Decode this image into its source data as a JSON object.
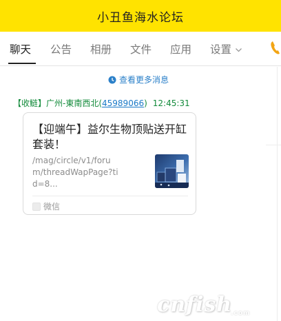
{
  "window": {
    "title": "小丑鱼海水论坛",
    "title_bar_color": "#ffe300"
  },
  "tabs": [
    {
      "label": "聊天",
      "active": true
    },
    {
      "label": "公告",
      "active": false
    },
    {
      "label": "相册",
      "active": false
    },
    {
      "label": "文件",
      "active": false
    },
    {
      "label": "应用",
      "active": false
    },
    {
      "label": "设置",
      "active": false,
      "icon": "chevron-down-icon"
    }
  ],
  "toolbar": {
    "call_icon": "phone-icon",
    "call_icon_color": "#f2a515"
  },
  "chat": {
    "more_messages_label": "查看更多消息",
    "more_messages_icon": "clock-icon",
    "message": {
      "sender_prefix": "【收鲢】广州-東南西北(",
      "sender_qq": "45989066",
      "sender_suffix": ")",
      "time": "12:45:31",
      "card": {
        "title": "【迎端午】益尔生物顶贴送开缸套装！",
        "url": "/mag/circle/v1/forum/threadWapPage?tid=8...",
        "thumbnail_icon": "product-thumbnail",
        "source_icon": "wechat-icon",
        "source_label": "微信"
      }
    }
  },
  "watermark": {
    "text": "cnfish",
    "sub": ".com"
  }
}
